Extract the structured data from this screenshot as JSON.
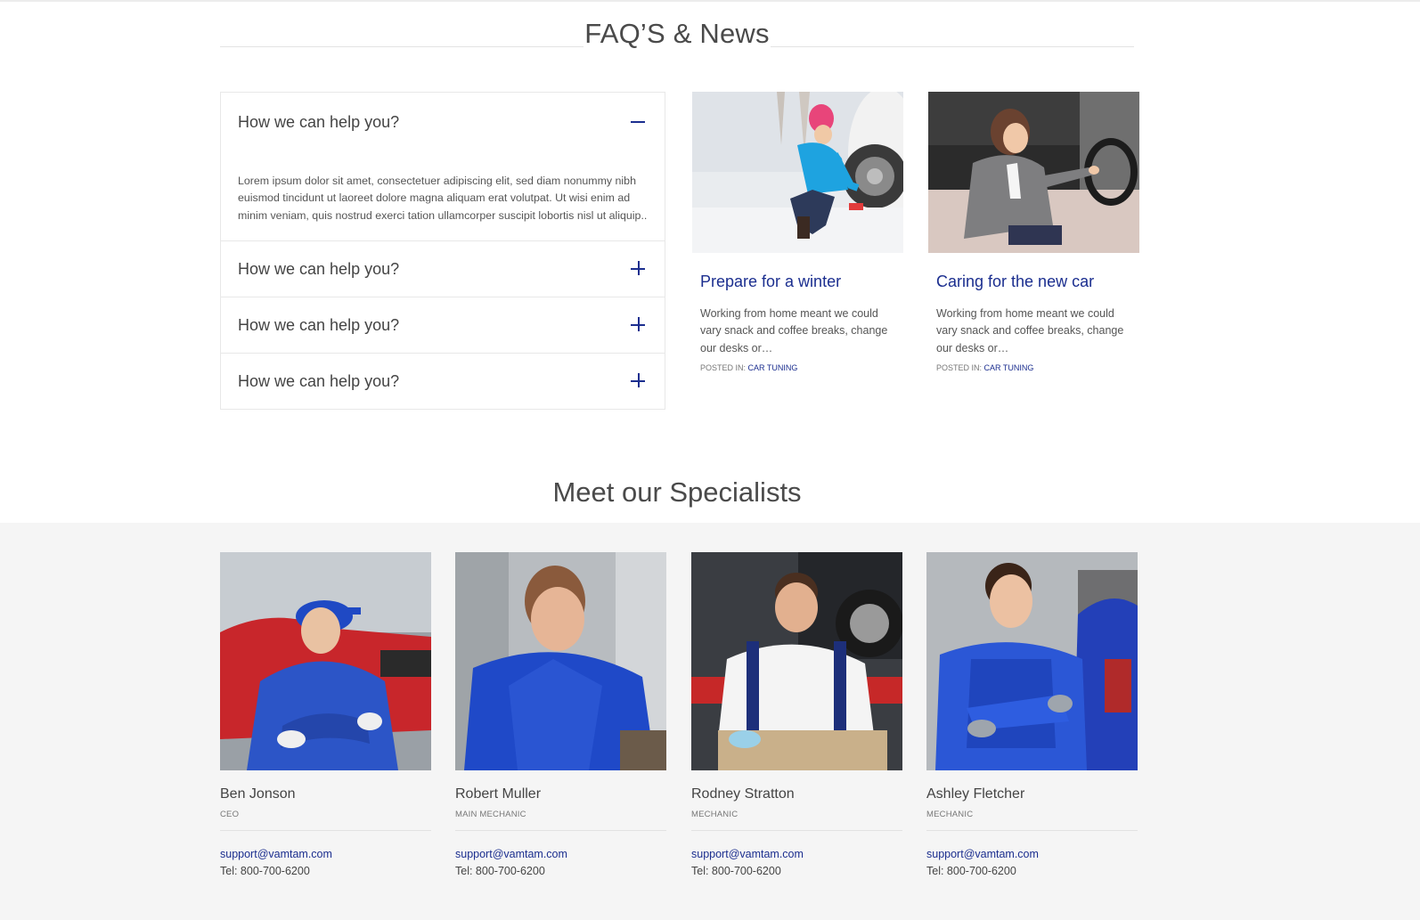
{
  "faq_section": {
    "title": "FAQ’S & News",
    "items": [
      {
        "question": "How we can help you?",
        "state": "open",
        "answer": "Lorem ipsum dolor sit amet, consectetuer adipiscing elit, sed diam nonummy nibh euismod tincidunt ut laoreet dolore magna aliquam erat volutpat. Ut wisi enim ad minim veniam, quis nostrud exerci tation ullamcorper suscipit lobortis nisl ut aliquip.."
      },
      {
        "question": "How we can help you?",
        "state": "closed"
      },
      {
        "question": "How we can help you?",
        "state": "closed"
      },
      {
        "question": "How we can help you?",
        "state": "closed"
      }
    ],
    "toggle_color": "#1b2e8f"
  },
  "news": [
    {
      "title": "Prepare for a winter",
      "excerpt": "Working from home meant we could vary snack and coffee breaks, change our desks or…",
      "posted_label": "POSTED IN:",
      "category": "CAR TUNING",
      "image_icon": "winter-tire-photo"
    },
    {
      "title": "Caring for the new car",
      "excerpt": "Working from home meant we could vary snack and coffee breaks, change our desks or…",
      "posted_label": "POSTED IN:",
      "category": "CAR TUNING",
      "image_icon": "woman-driving-photo"
    }
  ],
  "team_section": {
    "title": "Meet our Specialists",
    "members": [
      {
        "name": "Ben Jonson",
        "role": "CEO",
        "email": "support@vamtam.com",
        "tel": "Tel: 800-700-6200"
      },
      {
        "name": "Robert Muller",
        "role": "MAIN MECHANIC",
        "email": "support@vamtam.com",
        "tel": "Tel: 800-700-6200"
      },
      {
        "name": "Rodney Stratton",
        "role": "MECHANIC",
        "email": "support@vamtam.com",
        "tel": "Tel: 800-700-6200"
      },
      {
        "name": "Ashley Fletcher",
        "role": "MECHANIC",
        "email": "support@vamtam.com",
        "tel": "Tel: 800-700-6200"
      }
    ]
  },
  "colors": {
    "accent": "#1b2e8f",
    "band": "#f5f5f5",
    "text": "#444444"
  }
}
